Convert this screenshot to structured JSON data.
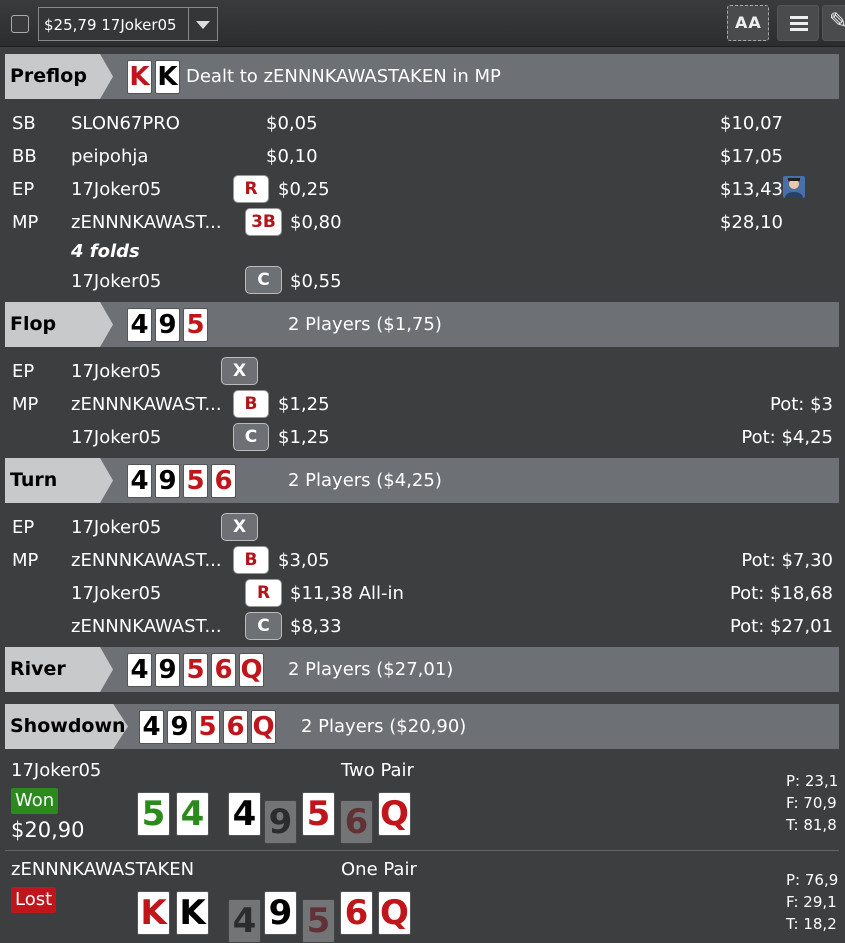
{
  "toolbar": {
    "hand_selector": "$25,79 17Joker05",
    "font_button_label": "AA"
  },
  "preflop": {
    "label": "Preflop",
    "info": "Dealt to zENNNKAWASTAKEN in MP",
    "hero_cards": [
      {
        "rank": "K",
        "color": "red"
      },
      {
        "rank": "K",
        "color": "black"
      }
    ],
    "rows": [
      {
        "pos": "SB",
        "name": "SLON67PRO",
        "action": "",
        "amount": "$0,05",
        "stack": "$10,07"
      },
      {
        "pos": "BB",
        "name": "peipohja",
        "action": "",
        "amount": "$0,10",
        "stack": "$17,05"
      },
      {
        "pos": "EP",
        "name": "17Joker05",
        "action": "R",
        "amount": "$0,25",
        "stack": "$13,43"
      },
      {
        "pos": "MP",
        "name": "zENNNKAWAST...",
        "action": "3B",
        "amount": "$0,80",
        "stack": "$28,10"
      },
      {
        "pos": "",
        "name": "4 folds",
        "action": "",
        "amount": "",
        "stack": ""
      },
      {
        "pos": "",
        "name": "17Joker05",
        "action": "C",
        "amount": "$0,55",
        "stack": ""
      }
    ]
  },
  "flop": {
    "label": "Flop",
    "info": "2 Players ($1,75)",
    "cards": [
      {
        "rank": "4",
        "color": "black"
      },
      {
        "rank": "9",
        "color": "black"
      },
      {
        "rank": "5",
        "color": "red"
      }
    ],
    "rows": [
      {
        "pos": "EP",
        "name": "17Joker05",
        "action": "X",
        "amount": "",
        "pot": ""
      },
      {
        "pos": "MP",
        "name": "zENNNKAWAST...",
        "action": "B",
        "amount": "$1,25",
        "pot": "Pot: $3"
      },
      {
        "pos": "",
        "name": "17Joker05",
        "action": "C",
        "amount": "$1,25",
        "pot": "Pot: $4,25"
      }
    ]
  },
  "turn": {
    "label": "Turn",
    "info": "2 Players ($4,25)",
    "cards": [
      {
        "rank": "4",
        "color": "black"
      },
      {
        "rank": "9",
        "color": "black"
      },
      {
        "rank": "5",
        "color": "red"
      },
      {
        "rank": "6",
        "color": "red"
      }
    ],
    "rows": [
      {
        "pos": "EP",
        "name": "17Joker05",
        "action": "X",
        "amount": "",
        "pot": ""
      },
      {
        "pos": "MP",
        "name": "zENNNKAWAST...",
        "action": "B",
        "amount": "$3,05",
        "pot": "Pot: $7,30"
      },
      {
        "pos": "",
        "name": "17Joker05",
        "action": "R",
        "amount": "$11,38 All-in",
        "pot": "Pot: $18,68"
      },
      {
        "pos": "",
        "name": "zENNNKAWAST...",
        "action": "C",
        "amount": "$8,33",
        "pot": "Pot: $27,01"
      }
    ]
  },
  "river": {
    "label": "River",
    "info": "2 Players ($27,01)",
    "cards": [
      {
        "rank": "4",
        "color": "black"
      },
      {
        "rank": "9",
        "color": "black"
      },
      {
        "rank": "5",
        "color": "red"
      },
      {
        "rank": "6",
        "color": "red"
      },
      {
        "rank": "Q",
        "color": "red"
      }
    ]
  },
  "showdown": {
    "label": "Showdown",
    "info": "2 Players ($20,90)",
    "cards": [
      {
        "rank": "4",
        "color": "black"
      },
      {
        "rank": "9",
        "color": "black"
      },
      {
        "rank": "5",
        "color": "red"
      },
      {
        "rank": "6",
        "color": "red"
      },
      {
        "rank": "Q",
        "color": "red"
      }
    ],
    "players": [
      {
        "name": "17Joker05",
        "hand": "Two Pair",
        "result": "Won",
        "winnings": "$20,90",
        "hole": [
          {
            "rank": "5",
            "color": "green"
          },
          {
            "rank": "4",
            "color": "green"
          }
        ],
        "stats": {
          "p": "P: 23,1",
          "f": "F: 70,9",
          "t": "T: 81,8"
        }
      },
      {
        "name": "zENNNKAWASTAKEN",
        "hand": "One Pair",
        "result": "Lost",
        "winnings": "",
        "hole": [
          {
            "rank": "K",
            "color": "red"
          },
          {
            "rank": "K",
            "color": "black"
          }
        ],
        "stats": {
          "p": "P: 76,9",
          "f": "F: 29,1",
          "t": "T: 18,2"
        }
      }
    ]
  },
  "colors": {
    "accent_red": "#c0151b",
    "won_green": "#2a8a1c",
    "section_bg": "#6d7074",
    "page_bg": "#3d3e40"
  }
}
